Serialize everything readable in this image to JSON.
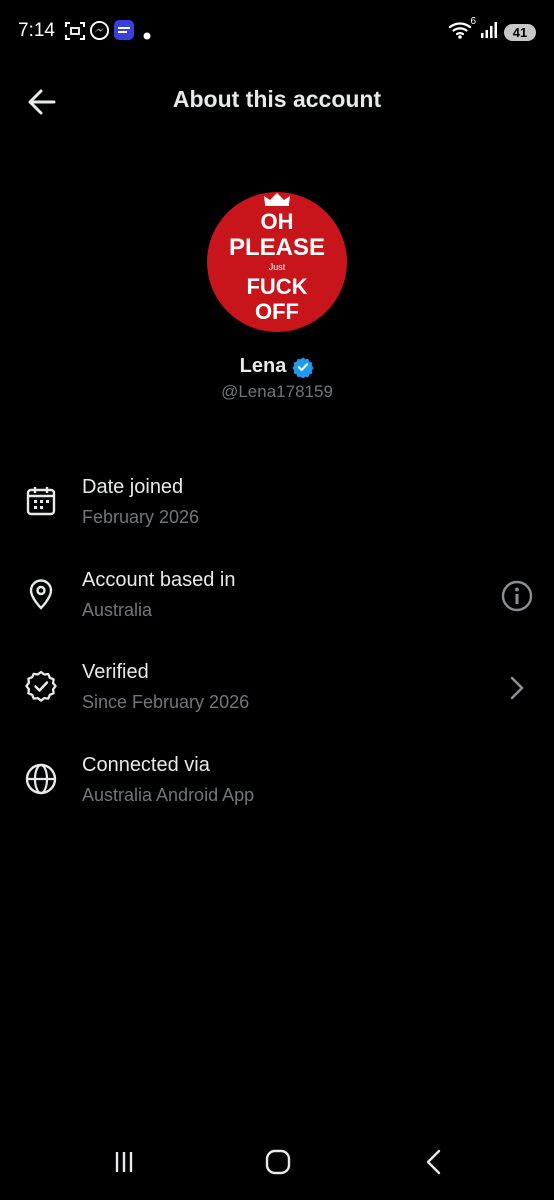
{
  "status_bar": {
    "time": "7:14",
    "battery": "41",
    "network": "6",
    "icons": [
      "screenshot-icon",
      "messenger-icon",
      "app-icon",
      "dot-icon",
      "wifi-icon",
      "signal-icon",
      "battery-icon"
    ]
  },
  "header": {
    "title": "About this account",
    "back_icon": "arrow-left-icon"
  },
  "profile": {
    "avatar_text": [
      "OH",
      "PLEASE",
      "Just",
      "FUCK",
      "OFF"
    ],
    "avatar_color": "#c8151b",
    "name": "Lena",
    "verified_color": "#1d9bf0",
    "handle": "@Lena178159"
  },
  "details": [
    {
      "icon": "calendar-icon",
      "label": "Date joined",
      "value": "February 2026"
    },
    {
      "icon": "location-pin-icon",
      "label": "Account based in",
      "value": "Australia",
      "trailing": "info-icon"
    },
    {
      "icon": "verified-badge-icon",
      "label": "Verified",
      "value": "Since February 2026",
      "trailing": "chevron-right-icon"
    },
    {
      "icon": "globe-icon",
      "label": "Connected via",
      "value": "Australia Android App"
    }
  ],
  "nav_bar": {
    "icons": [
      "recent-apps-icon",
      "home-icon",
      "back-icon"
    ]
  }
}
